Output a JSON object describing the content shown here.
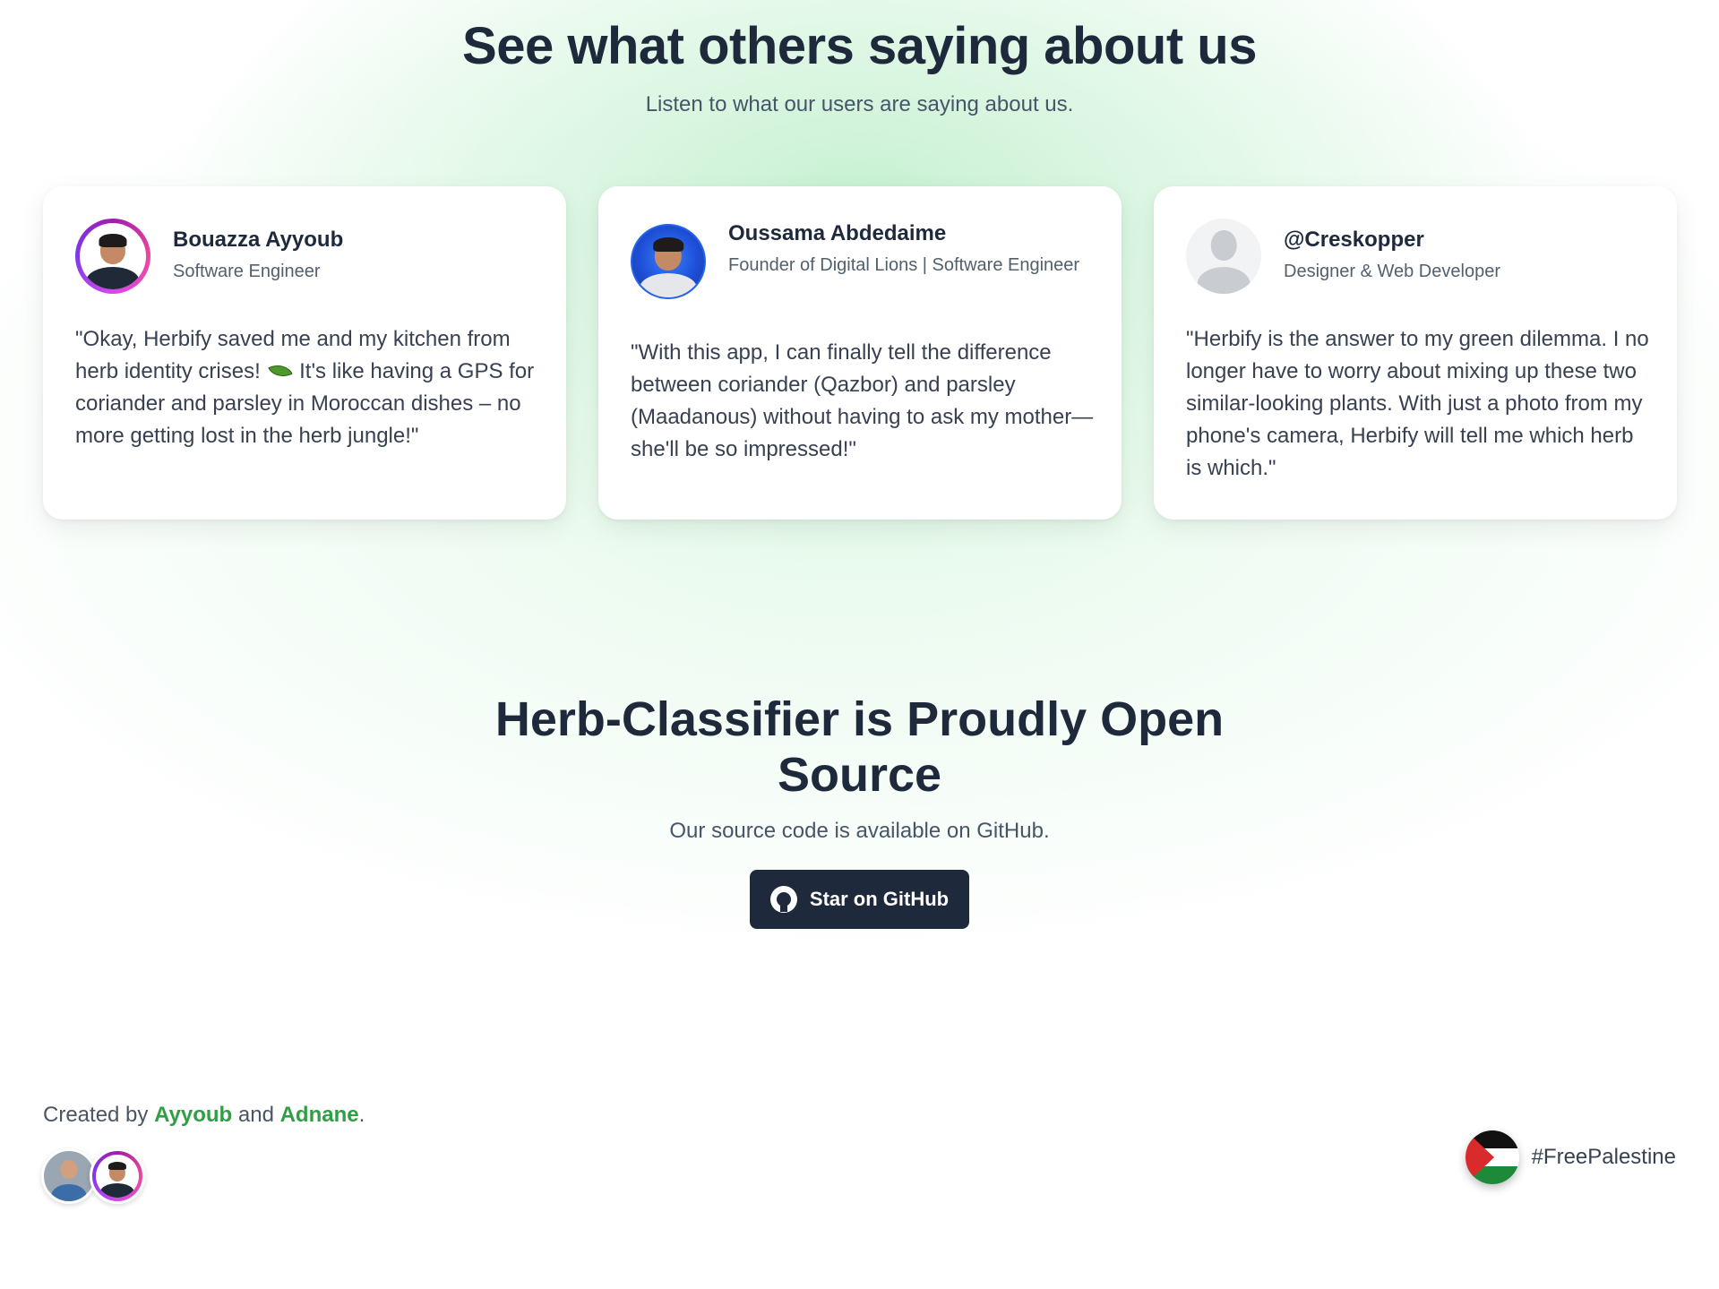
{
  "testimonials": {
    "title": "See what others saying about us",
    "subtitle": "Listen to what our users are saying about us.",
    "cards": [
      {
        "name": "Bouazza Ayyoub",
        "role": "Software Engineer",
        "quote_part1": "\"Okay, Herbify saved me and my kitchen from herb identity crises!",
        "quote_part2": "It's like having a GPS for coriander and parsley in Moroccan dishes – no more getting lost in the herb jungle!\""
      },
      {
        "name": "Oussama Abdedaime",
        "role": "Founder of Digital Lions | Software Engineer",
        "quote": "\"With this app, I can finally tell the difference between coriander (Qazbor) and parsley (Maadanous) without having to ask my mother—she'll be so impressed!\""
      },
      {
        "name": "@Creskopper",
        "role": "Designer & Web Developer",
        "quote": "\"Herbify is the answer to my green dilemma. I no longer have to worry about mixing up these two similar-looking plants. With just a photo from my phone's camera, Herbify will tell me which herb is which.\""
      }
    ]
  },
  "open_source": {
    "title": "Herb-Classifier is Proudly Open Source",
    "subtitle": "Our source code is available on GitHub.",
    "button_label": "Star on GitHub"
  },
  "footer": {
    "created_by": "Created by",
    "author1": "Ayyoub",
    "and": "and",
    "author2": "Adnane",
    "period": ".",
    "hashtag": "#FreePalestine"
  },
  "colors": {
    "accent_green": "#2f9e44",
    "dark": "#1e293b",
    "background_glow": "#c4f0d0"
  },
  "icons": [
    "github-icon",
    "leaf-icon",
    "palestine-flag-icon",
    "default-user-icon"
  ]
}
